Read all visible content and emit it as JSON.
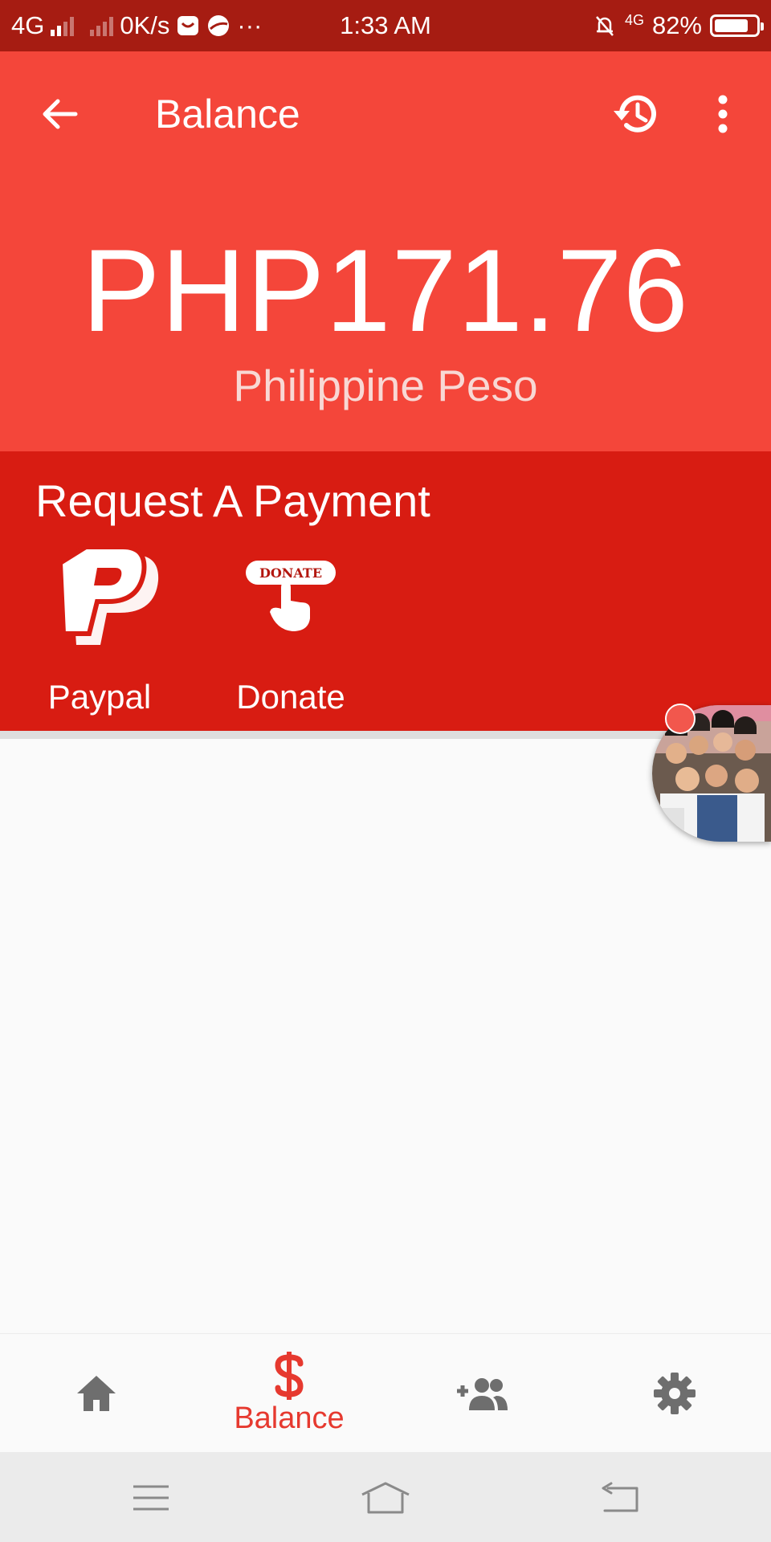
{
  "status_bar": {
    "network_left": "4G",
    "speed": "0K/s",
    "more": "···",
    "time": "1:33 AM",
    "network_right": "4G",
    "battery": "82%",
    "battery_level": 0.82
  },
  "app_bar": {
    "title": "Balance",
    "back_icon": "arrow-left-icon",
    "history_icon": "history-icon",
    "more_icon": "more-vert-icon"
  },
  "balance": {
    "amount": "PHP171.76",
    "currency_name": "Philippine Peso"
  },
  "request_payment": {
    "title": "Request A Payment",
    "options": [
      {
        "label": "Paypal",
        "icon": "paypal-icon"
      },
      {
        "label": "Donate",
        "icon": "donate-icon",
        "badge_text": "DONATE"
      }
    ]
  },
  "bottom_nav": {
    "items": [
      {
        "icon": "home-icon"
      },
      {
        "icon": "dollar-icon",
        "label": "Balance",
        "active": true
      },
      {
        "icon": "add-friend-icon"
      },
      {
        "icon": "gear-icon"
      }
    ]
  },
  "system_nav": {
    "items": [
      "menu-icon",
      "home-outline-icon",
      "back-icon"
    ]
  },
  "colors": {
    "status_bar": "#a61c12",
    "app_bar": "#f4463a",
    "request_area": "#d81c12",
    "accent": "#e6392f",
    "nav_icon": "#6e6e6e"
  }
}
